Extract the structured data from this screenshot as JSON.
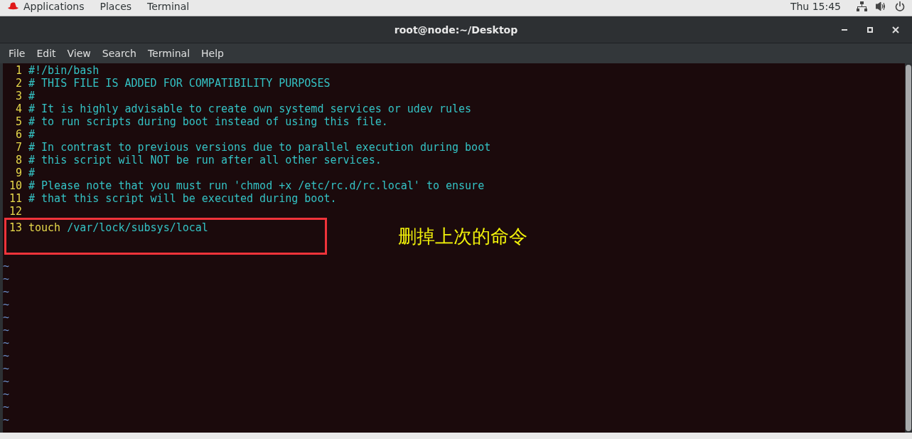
{
  "top_bar": {
    "menus": [
      "Applications",
      "Places",
      "Terminal"
    ],
    "clock": "Thu 15:45"
  },
  "window": {
    "title": "root@node:~/Desktop"
  },
  "menu_bar": [
    "File",
    "Edit",
    "View",
    "Search",
    "Terminal",
    "Help"
  ],
  "editor": {
    "lines": [
      {
        "number": "1",
        "segments": [
          {
            "kind": "comment",
            "text": "#!/bin/bash"
          }
        ]
      },
      {
        "number": "2",
        "segments": [
          {
            "kind": "comment",
            "text": "# THIS FILE IS ADDED FOR COMPATIBILITY PURPOSES"
          }
        ]
      },
      {
        "number": "3",
        "segments": [
          {
            "kind": "comment",
            "text": "#"
          }
        ]
      },
      {
        "number": "4",
        "segments": [
          {
            "kind": "comment",
            "text": "# It is highly advisable to create own systemd services or udev rules"
          }
        ]
      },
      {
        "number": "5",
        "segments": [
          {
            "kind": "comment",
            "text": "# to run scripts during boot instead of using this file."
          }
        ]
      },
      {
        "number": "6",
        "segments": [
          {
            "kind": "comment",
            "text": "#"
          }
        ]
      },
      {
        "number": "7",
        "segments": [
          {
            "kind": "comment",
            "text": "# In contrast to previous versions due to parallel execution during boot"
          }
        ]
      },
      {
        "number": "8",
        "segments": [
          {
            "kind": "comment",
            "text": "# this script will NOT be run after all other services."
          }
        ]
      },
      {
        "number": "9",
        "segments": [
          {
            "kind": "comment",
            "text": "#"
          }
        ]
      },
      {
        "number": "10",
        "segments": [
          {
            "kind": "comment",
            "text": "# Please note that you must run 'chmod +x /etc/rc.d/rc.local' to ensure"
          }
        ]
      },
      {
        "number": "11",
        "segments": [
          {
            "kind": "comment",
            "text": "# that this script will be executed during boot."
          }
        ]
      },
      {
        "number": "12"
      },
      {
        "number": "13",
        "segments": [
          {
            "kind": "command",
            "text": "touch"
          },
          {
            "kind": "path",
            "text": " /var/lock/subsys/local"
          }
        ]
      }
    ],
    "empty_markers": [
      "~",
      "~",
      "~",
      "~",
      "~",
      "~",
      "~",
      "~",
      "~",
      "~",
      "~",
      "~",
      "~"
    ]
  },
  "annotation": {
    "note": "删掉上次的命令"
  }
}
